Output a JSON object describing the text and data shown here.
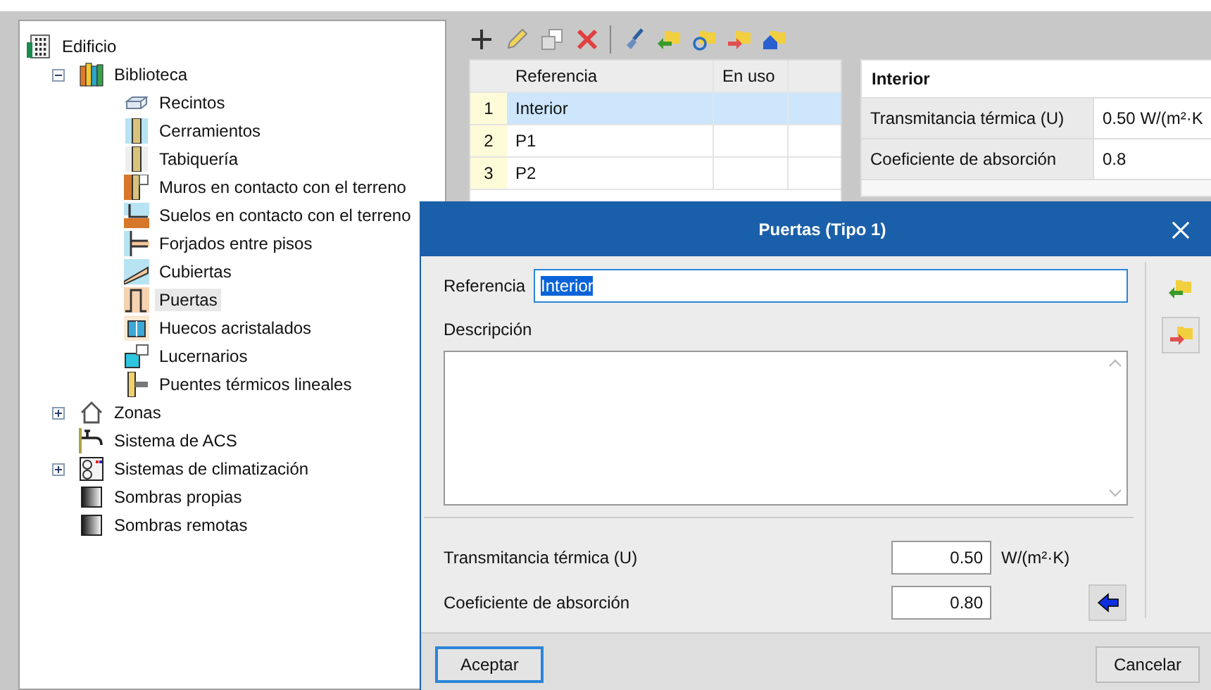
{
  "tree": [
    {
      "label": "Edificio",
      "kind": "building",
      "selected": false,
      "children": [
        {
          "label": "Biblioteca",
          "kind": "books",
          "expanded": true,
          "selected": false,
          "children": [
            {
              "label": "Recintos",
              "kind": "room",
              "selected": false
            },
            {
              "label": "Cerramientos",
              "kind": "wall",
              "selected": false
            },
            {
              "label": "Tabiquería",
              "kind": "partition",
              "selected": false
            },
            {
              "label": "Muros en contacto con el terreno",
              "kind": "ground-wall",
              "selected": false
            },
            {
              "label": "Suelos en contacto con el terreno",
              "kind": "ground-floor",
              "selected": false
            },
            {
              "label": "Forjados entre pisos",
              "kind": "slab",
              "selected": false
            },
            {
              "label": "Cubiertas",
              "kind": "roof",
              "selected": false
            },
            {
              "label": "Puertas",
              "kind": "door",
              "selected": true
            },
            {
              "label": "Huecos acristalados",
              "kind": "window",
              "selected": false
            },
            {
              "label": "Lucernarios",
              "kind": "skylight",
              "selected": false
            },
            {
              "label": "Puentes térmicos lineales",
              "kind": "bridge",
              "selected": false
            }
          ]
        },
        {
          "label": "Zonas",
          "kind": "house",
          "expanded": false,
          "selected": false
        },
        {
          "label": "Sistema de ACS",
          "kind": "tap",
          "selected": false
        },
        {
          "label": "Sistemas de climatización",
          "kind": "hvac",
          "expanded": false,
          "selected": false
        },
        {
          "label": "Sombras propias",
          "kind": "shade",
          "selected": false
        },
        {
          "label": "Sombras remotas",
          "kind": "shade",
          "selected": false
        }
      ]
    }
  ],
  "toolbar": [
    {
      "kind": "add"
    },
    {
      "kind": "edit"
    },
    {
      "kind": "copy"
    },
    {
      "kind": "delete"
    },
    {
      "kind": "separator"
    },
    {
      "kind": "brush"
    },
    {
      "kind": "import"
    },
    {
      "kind": "refresh"
    },
    {
      "kind": "export"
    },
    {
      "kind": "home"
    }
  ],
  "table": {
    "columns": [
      "Referencia",
      "En uso"
    ],
    "rows": [
      {
        "index": "1",
        "referencia": "Interior",
        "selected": true
      },
      {
        "index": "2",
        "referencia": "P1",
        "selected": false
      },
      {
        "index": "3",
        "referencia": "P2",
        "selected": false
      }
    ]
  },
  "properties": {
    "title": "Interior",
    "rows": [
      {
        "label": "Transmitancia térmica (U)",
        "value": "0.50 W/(m²·K"
      },
      {
        "label": "Coeficiente de absorción",
        "value": "0.8"
      }
    ]
  },
  "dialog": {
    "title": "Puertas (Tipo 1)",
    "referencia_label": "Referencia",
    "referencia_value": "Interior",
    "descripcion_label": "Descripción",
    "fields": [
      {
        "label": "Transmitancia térmica (U)",
        "value": "0.50",
        "unit": "W/(m²·K)"
      },
      {
        "label": "Coeficiente de absorción",
        "value": "0.80"
      }
    ],
    "ok": "Aceptar",
    "cancel": "Cancelar"
  }
}
